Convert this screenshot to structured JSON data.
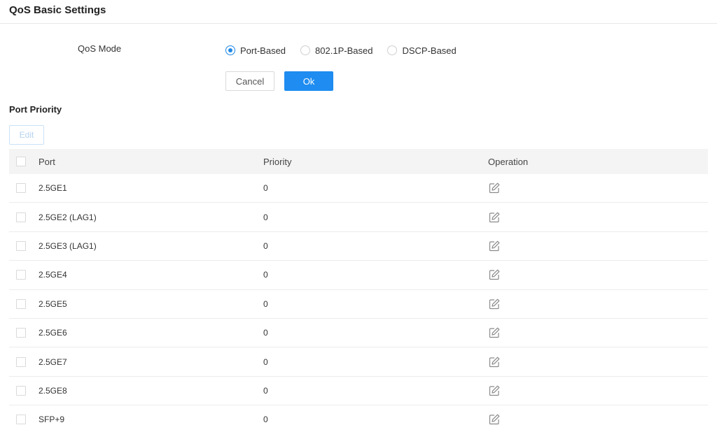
{
  "header": {
    "title": "QoS Basic Settings"
  },
  "qos_mode": {
    "label": "QoS Mode",
    "options": [
      {
        "label": "Port-Based",
        "checked": true
      },
      {
        "label": "802.1P-Based",
        "checked": false
      },
      {
        "label": "DSCP-Based",
        "checked": false
      }
    ]
  },
  "actions": {
    "cancel_label": "Cancel",
    "ok_label": "Ok"
  },
  "port_priority": {
    "title": "Port Priority",
    "edit_label": "Edit",
    "columns": {
      "port": "Port",
      "priority": "Priority",
      "operation": "Operation"
    },
    "rows": [
      {
        "port": "2.5GE1",
        "priority": "0"
      },
      {
        "port": "2.5GE2 (LAG1)",
        "priority": "0"
      },
      {
        "port": "2.5GE3 (LAG1)",
        "priority": "0"
      },
      {
        "port": "2.5GE4",
        "priority": "0"
      },
      {
        "port": "2.5GE5",
        "priority": "0"
      },
      {
        "port": "2.5GE6",
        "priority": "0"
      },
      {
        "port": "2.5GE7",
        "priority": "0"
      },
      {
        "port": "2.5GE8",
        "priority": "0"
      },
      {
        "port": "SFP+9",
        "priority": "0"
      }
    ],
    "operation_icon": "edit-icon"
  },
  "colors": {
    "accent": "#1e8cf0",
    "header_bg": "#f4f4f4",
    "border": "#ececec"
  }
}
